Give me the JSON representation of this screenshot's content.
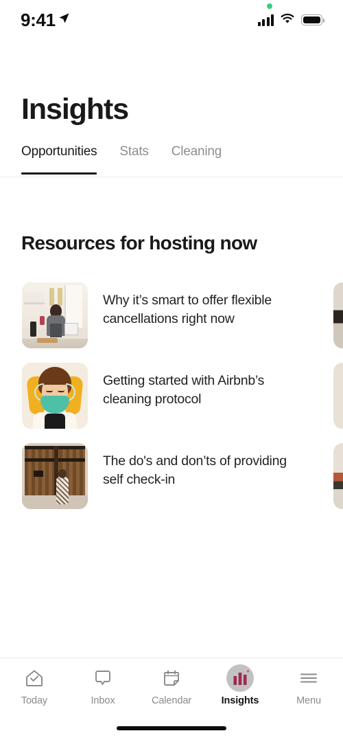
{
  "status_bar": {
    "time": "9:41",
    "location_icon": "location-arrow-icon",
    "recording_dot": "green-recording-dot",
    "signal_icon": "cellular-signal-icon",
    "wifi_icon": "wifi-icon",
    "battery_icon": "battery-full-icon"
  },
  "header": {
    "title": "Insights",
    "tabs": [
      {
        "label": "Opportunities",
        "active": true
      },
      {
        "label": "Stats",
        "active": false
      },
      {
        "label": "Cleaning",
        "active": false
      }
    ]
  },
  "main": {
    "section_title": "Resources for hosting now",
    "cards": [
      {
        "title": "Why it’s smart to offer flexible cancellations right now",
        "thumbnail": "host-in-kitchen-with-laptop-photo"
      },
      {
        "title": "Getting started with Airbnb’s cleaning protocol",
        "thumbnail": "person-wearing-mask-and-gloves-illustration"
      },
      {
        "title": "The do's and don’ts of providing self check-in",
        "thumbnail": "wooden-gate-with-person-photo"
      }
    ]
  },
  "bottom_nav": {
    "items": [
      {
        "label": "Today",
        "icon": "home-check-icon",
        "active": false
      },
      {
        "label": "Inbox",
        "icon": "speech-bubble-icon",
        "active": false
      },
      {
        "label": "Calendar",
        "icon": "calendar-icon",
        "active": false
      },
      {
        "label": "Insights",
        "icon": "bar-chart-icon",
        "active": true
      },
      {
        "label": "Menu",
        "icon": "hamburger-menu-icon",
        "active": false
      }
    ]
  },
  "colors": {
    "text_primary": "#191919",
    "text_muted": "#8e8e8e",
    "accent_insights": "#9d2b4e",
    "divider": "#ebebeb",
    "recording_dot": "#3ad07a"
  }
}
